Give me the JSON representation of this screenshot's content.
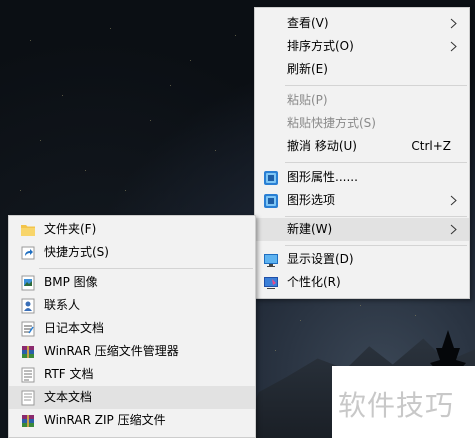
{
  "main_menu": {
    "items": [
      {
        "label": "查看(V)",
        "has_submenu": true,
        "disabled": false
      },
      {
        "label": "排序方式(O)",
        "has_submenu": true,
        "disabled": false
      },
      {
        "label": "刷新(E)",
        "has_submenu": false,
        "disabled": false
      },
      {
        "label": "粘贴(P)",
        "has_submenu": false,
        "disabled": true
      },
      {
        "label": "粘贴快捷方式(S)",
        "has_submenu": false,
        "disabled": true
      },
      {
        "label": "撤消 移动(U)",
        "shortcut": "Ctrl+Z",
        "disabled": false
      },
      {
        "label": "图形属性......",
        "icon": "intel-graphics-icon",
        "disabled": false
      },
      {
        "label": "图形选项",
        "icon": "intel-graphics-icon",
        "has_submenu": true,
        "disabled": false
      },
      {
        "label": "新建(W)",
        "has_submenu": true,
        "highlighted": true,
        "disabled": false
      },
      {
        "label": "显示设置(D)",
        "icon": "display-icon",
        "disabled": false
      },
      {
        "label": "个性化(R)",
        "icon": "personalize-icon",
        "disabled": false
      }
    ]
  },
  "new_submenu": {
    "items": [
      {
        "label": "文件夹(F)",
        "icon": "folder-icon"
      },
      {
        "label": "快捷方式(S)",
        "icon": "shortcut-icon"
      },
      {
        "label": "BMP 图像",
        "icon": "bmp-icon"
      },
      {
        "label": "联系人",
        "icon": "contact-icon"
      },
      {
        "label": "日记本文档",
        "icon": "journal-icon"
      },
      {
        "label": "WinRAR 压缩文件管理器",
        "icon": "winrar-icon"
      },
      {
        "label": "RTF 文档",
        "icon": "rtf-icon"
      },
      {
        "label": "文本文档",
        "icon": "text-document-icon",
        "highlighted": true
      },
      {
        "label": "WinRAR ZIP 压缩文件",
        "icon": "winrar-zip-icon"
      }
    ]
  },
  "watermark": {
    "text": "软件技巧"
  },
  "colors": {
    "menu_bg": "#f2f2f2",
    "highlight_bg": "#e2e2e2",
    "disabled_text": "#8a8a8a",
    "desktop_bg": "#0b0f14"
  }
}
